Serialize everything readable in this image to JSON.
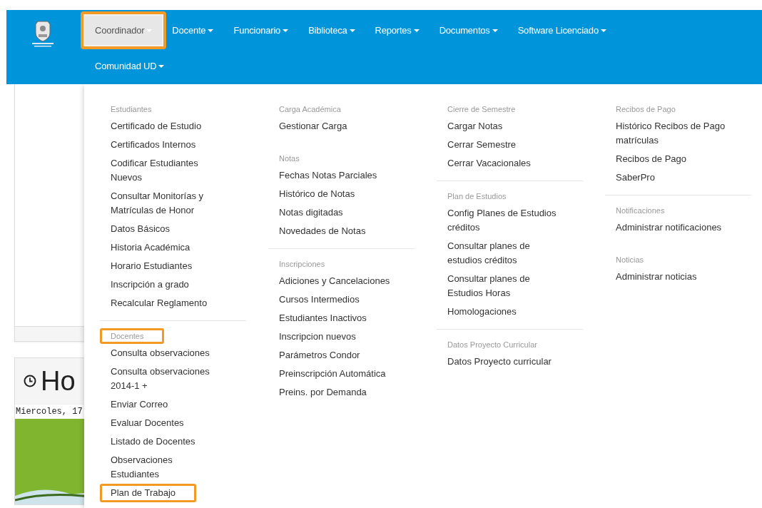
{
  "navbar": {
    "items": [
      {
        "label": "Coordinador",
        "selected": true,
        "highlighted": true
      },
      {
        "label": "Docente",
        "selected": false,
        "highlighted": false
      },
      {
        "label": "Funcionario",
        "selected": false,
        "highlighted": false
      },
      {
        "label": "Biblioteca",
        "selected": false,
        "highlighted": false
      },
      {
        "label": "Reportes",
        "selected": false,
        "highlighted": false
      },
      {
        "label": "Documentos",
        "selected": false,
        "highlighted": false
      },
      {
        "label": "Software Licenciado",
        "selected": false,
        "highlighted": false
      },
      {
        "label": "Comunidad UD",
        "selected": false,
        "highlighted": false
      }
    ]
  },
  "clock_card": {
    "title": "Ho",
    "date": "Miercoles, 17"
  },
  "dropdown": {
    "columns": [
      {
        "entries": [
          {
            "kind": "header",
            "text": "Estudiantes",
            "highlighted": false
          },
          {
            "kind": "item",
            "text": "Certificado de Estudio",
            "highlighted": false
          },
          {
            "kind": "item",
            "text": "Certificados Internos",
            "highlighted": false
          },
          {
            "kind": "item",
            "text": "Codificar Estudiantes Nuevos",
            "highlighted": false
          },
          {
            "kind": "item",
            "text": "Consultar Monitorías y Matrículas de Honor",
            "highlighted": false
          },
          {
            "kind": "item",
            "text": "Datos Básicos",
            "highlighted": false
          },
          {
            "kind": "item",
            "text": "Historia Académica",
            "highlighted": false
          },
          {
            "kind": "item",
            "text": "Horario Estudiantes",
            "highlighted": false
          },
          {
            "kind": "item",
            "text": "Inscripción a grado",
            "highlighted": false
          },
          {
            "kind": "item",
            "text": "Recalcular Reglamento",
            "highlighted": false
          },
          {
            "kind": "divider"
          },
          {
            "kind": "header",
            "text": "Docentes",
            "highlighted": true
          },
          {
            "kind": "item",
            "text": "Consulta observaciones",
            "highlighted": false
          },
          {
            "kind": "item",
            "text": "Consulta observaciones 2014-1 +",
            "highlighted": false
          },
          {
            "kind": "item",
            "text": "Enviar Correo",
            "highlighted": false
          },
          {
            "kind": "item",
            "text": "Evaluar Docentes",
            "highlighted": false
          },
          {
            "kind": "item",
            "text": "Listado de Docentes",
            "highlighted": false
          },
          {
            "kind": "item",
            "text": "Observaciones Estudiantes",
            "highlighted": false
          },
          {
            "kind": "item",
            "text": "Plan de Trabajo",
            "highlighted": true
          }
        ]
      },
      {
        "entries": [
          {
            "kind": "header",
            "text": "Carga Académica",
            "highlighted": false
          },
          {
            "kind": "item",
            "text": "Gestionar Carga",
            "highlighted": false
          },
          {
            "kind": "gap"
          },
          {
            "kind": "header",
            "text": "Notas",
            "highlighted": false
          },
          {
            "kind": "item",
            "text": "Fechas Notas Parciales",
            "highlighted": false
          },
          {
            "kind": "item",
            "text": "Histórico de Notas",
            "highlighted": false
          },
          {
            "kind": "item",
            "text": "Notas digitadas",
            "highlighted": false
          },
          {
            "kind": "item",
            "text": "Novedades de Notas",
            "highlighted": false
          },
          {
            "kind": "divider"
          },
          {
            "kind": "header",
            "text": "Inscripciones",
            "highlighted": false
          },
          {
            "kind": "item",
            "text": "Adiciones y Cancelaciones",
            "highlighted": false
          },
          {
            "kind": "item",
            "text": "Cursos Intermedios",
            "highlighted": false
          },
          {
            "kind": "item",
            "text": "Estudiantes Inactivos",
            "highlighted": false
          },
          {
            "kind": "item",
            "text": "Inscripcion nuevos",
            "highlighted": false
          },
          {
            "kind": "item",
            "text": "Parámetros Condor",
            "highlighted": false
          },
          {
            "kind": "item",
            "text": "Preinscripción Automática",
            "highlighted": false
          },
          {
            "kind": "item",
            "text": "Preins. por Demanda",
            "highlighted": false
          }
        ]
      },
      {
        "entries": [
          {
            "kind": "header",
            "text": "Cierre de Semestre",
            "highlighted": false
          },
          {
            "kind": "item",
            "text": "Cargar Notas",
            "highlighted": false
          },
          {
            "kind": "item",
            "text": "Cerrar Semestre",
            "highlighted": false
          },
          {
            "kind": "item",
            "text": "Cerrar Vacacionales",
            "highlighted": false
          },
          {
            "kind": "divider"
          },
          {
            "kind": "header",
            "text": "Plan de Estudios",
            "highlighted": false
          },
          {
            "kind": "item",
            "text": "Config Planes de Estudios créditos",
            "highlighted": false
          },
          {
            "kind": "item",
            "text": "Consultar planes de estudios créditos",
            "highlighted": false
          },
          {
            "kind": "item",
            "text": "Consultar planes de Estudios Horas",
            "highlighted": false
          },
          {
            "kind": "item",
            "text": "Homologaciones",
            "highlighted": false
          },
          {
            "kind": "divider"
          },
          {
            "kind": "header",
            "text": "Datos Proyecto Curricular",
            "highlighted": false
          },
          {
            "kind": "item",
            "text": "Datos Proyecto curricular",
            "highlighted": false
          }
        ]
      },
      {
        "entries": [
          {
            "kind": "header",
            "text": "Recibos de Pago",
            "highlighted": false
          },
          {
            "kind": "item",
            "text": "Histórico Recibos de Pago matrículas",
            "highlighted": false
          },
          {
            "kind": "item",
            "text": "Recibos de Pago",
            "highlighted": false
          },
          {
            "kind": "item",
            "text": "SaberPro",
            "highlighted": false
          },
          {
            "kind": "divider"
          },
          {
            "kind": "header",
            "text": "Notificaciones",
            "highlighted": false
          },
          {
            "kind": "item",
            "text": "Administrar notificaciones",
            "highlighted": false
          },
          {
            "kind": "gap"
          },
          {
            "kind": "header",
            "text": "Noticias",
            "highlighted": false
          },
          {
            "kind": "item",
            "text": "Administrar noticias",
            "highlighted": false
          }
        ]
      }
    ]
  }
}
